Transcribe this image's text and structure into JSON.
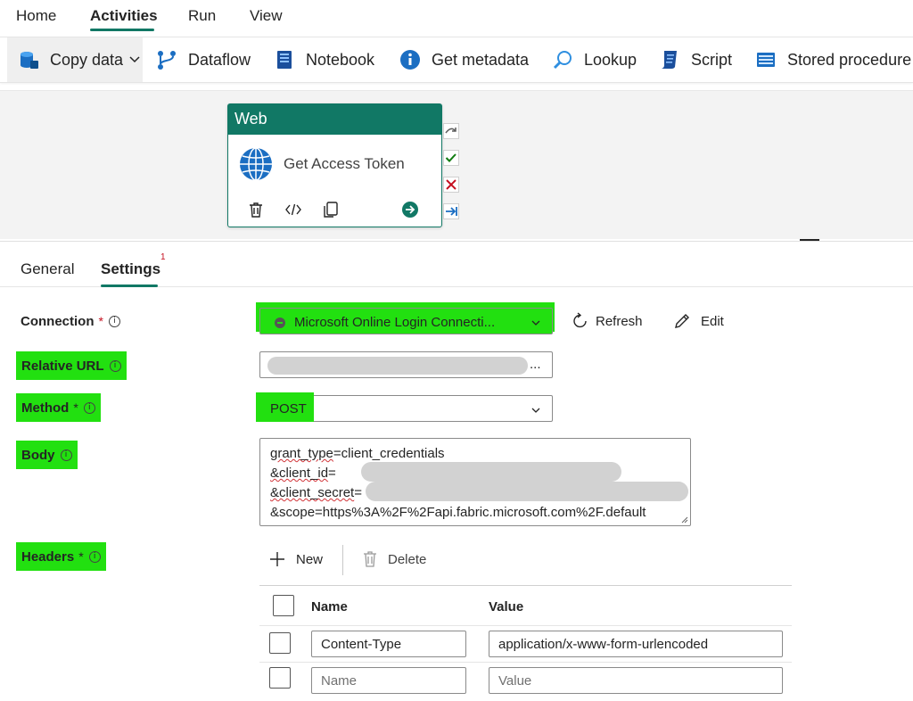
{
  "topnav": {
    "tabs": [
      {
        "label": "Home"
      },
      {
        "label": "Activities",
        "active": true
      },
      {
        "label": "Run"
      },
      {
        "label": "View"
      }
    ]
  },
  "toolbar": {
    "items": [
      {
        "label": "Copy data",
        "icon": "copy-data-icon"
      },
      {
        "label": "Dataflow",
        "icon": "dataflow-icon"
      },
      {
        "label": "Notebook",
        "icon": "notebook-icon"
      },
      {
        "label": "Get metadata",
        "icon": "info-icon"
      },
      {
        "label": "Lookup",
        "icon": "lookup-icon"
      },
      {
        "label": "Script",
        "icon": "script-icon"
      },
      {
        "label": "Stored procedure",
        "icon": "stored-procedure-icon"
      }
    ]
  },
  "activity_card": {
    "type_label": "Web",
    "name": "Get Access Token"
  },
  "settings_tabs": {
    "general": "General",
    "settings": "Settings",
    "settings_badge": "1"
  },
  "form": {
    "connection": {
      "label": "Connection",
      "required": "*",
      "value": "Microsoft Online Login Connecti...",
      "refresh": "Refresh",
      "edit": "Edit"
    },
    "relative_url": {
      "label": "Relative URL",
      "value_suffix": "..."
    },
    "method": {
      "label": "Method",
      "required": "*",
      "value": "POST"
    },
    "body": {
      "label": "Body",
      "line1_key": "grant_type",
      "line1_rest": "=client_credentials",
      "line2_key": "&client_id",
      "line2_rest": "=",
      "line3_key": "&client_secret",
      "line3_rest": "=",
      "line4": "&scope=https%3A%2F%2Fapi.fabric.microsoft.com%2F.default"
    },
    "headers": {
      "label": "Headers",
      "required": "*",
      "new": "New",
      "delete": "Delete",
      "col_name": "Name",
      "col_value": "Value",
      "rows": [
        {
          "name": "Content-Type",
          "value": "application/x-www-form-urlencoded"
        }
      ],
      "placeholder_name": "Name",
      "placeholder_value": "Value"
    }
  },
  "colors": {
    "accent": "#117865",
    "highlight": "#22e010",
    "error": "#c50f1f"
  }
}
